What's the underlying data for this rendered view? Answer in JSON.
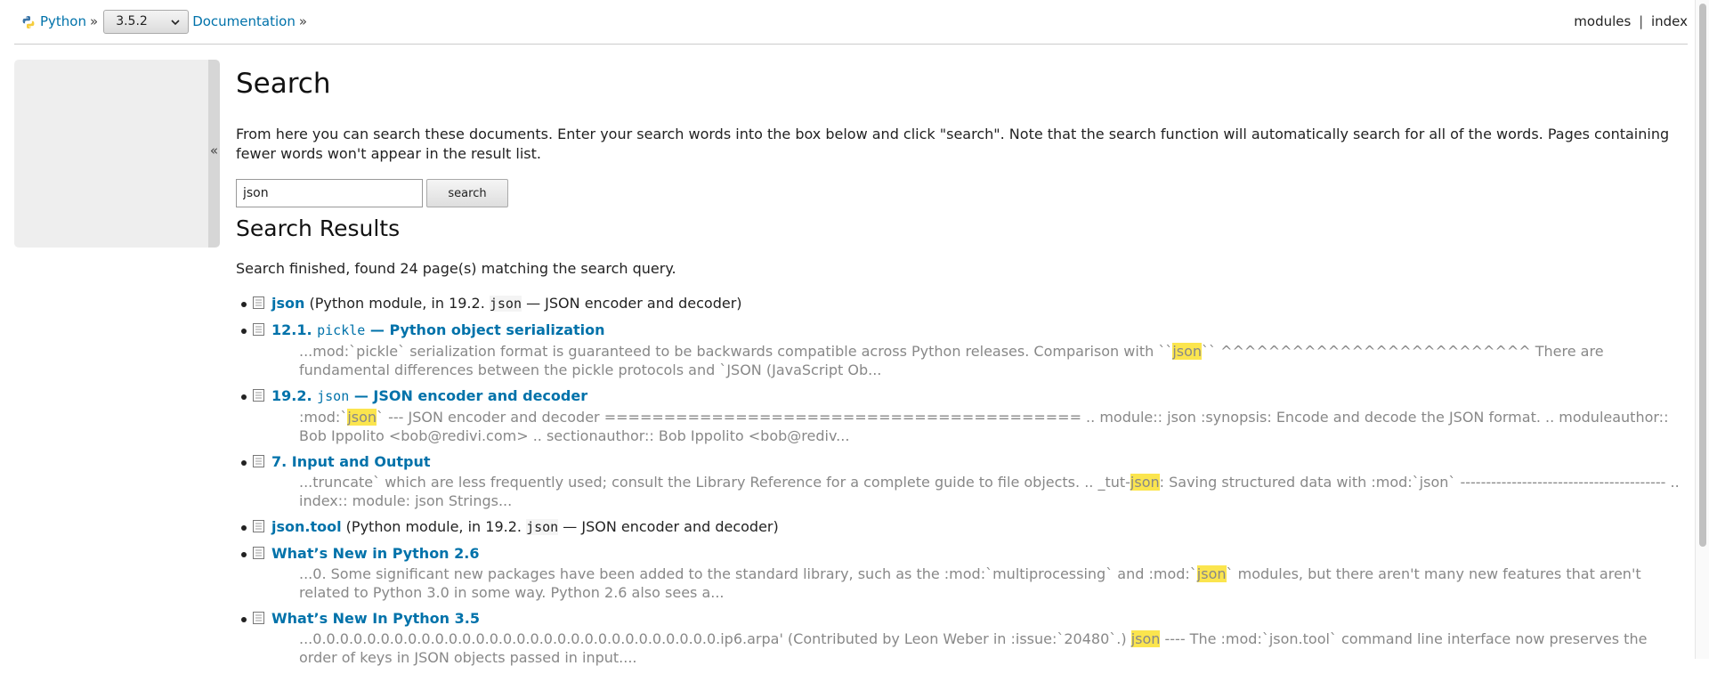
{
  "nav": {
    "python_label": "Python",
    "chevron": "»",
    "version": "3.5.2",
    "documentation_label": "Documentation",
    "modules": "modules",
    "divider": "|",
    "index": "index"
  },
  "sidebar": {
    "toggle": "«"
  },
  "page": {
    "title": "Search",
    "intro": "From here you can search these documents. Enter your search words into the box below and click \"search\". Note that the search function will automatically search for all of the words. Pages containing fewer words won't appear in the result list."
  },
  "search": {
    "value": "json",
    "button": "search"
  },
  "results": {
    "heading": "Search Results",
    "status": "Search finished, found 24 page(s) matching the search query.",
    "items": [
      {
        "title": "json",
        "info_pre": " (Python module, in 19.2. ",
        "info_code": "json",
        "info_post": " — JSON encoder and decoder)"
      },
      {
        "title_pre": "12.1. ",
        "title_code": "pickle",
        "title_post": " — Python object serialization",
        "context_pre": "...mod:`pickle` serialization format is guaranteed to be backwards compatible across Python releases. Comparison with ``",
        "context_hl": "json",
        "context_post": "`` ^^^^^^^^^^^^^^^^^^^^^^^^^^ There are fundamental differences between the pickle protocols and `JSON (JavaScript Ob..."
      },
      {
        "title_pre": "19.2. ",
        "title_code": "json",
        "title_post": " — JSON encoder and decoder",
        "context_pre": ":mod:`",
        "context_hl": "json",
        "context_post": "` --- JSON encoder and decoder ======================================== .. module:: json :synopsis: Encode and decode the JSON format. .. moduleauthor:: Bob Ippolito <bob@redivi.com> .. sectionauthor:: Bob Ippolito <bob@rediv..."
      },
      {
        "title": "7. Input and Output",
        "context_pre": "...truncate` which are less frequently used; consult the Library Reference for a complete guide to file objects. .. _tut-",
        "context_hl": "json",
        "context_post": ": Saving structured data with :mod:`json` ---------------------------------------- .. index:: module: json Strings..."
      },
      {
        "title": "json.tool",
        "info_pre": " (Python module, in 19.2. ",
        "info_code": "json",
        "info_post": " — JSON encoder and decoder)"
      },
      {
        "title": "What’s New in Python 2.6",
        "context_pre": "...0. Some significant new packages have been added to the standard library, such as the :mod:`multiprocessing` and :mod:`",
        "context_hl": "json",
        "context_post": "` modules, but there aren't many new features that aren't related to Python 3.0 in some way. Python 2.6 also sees a..."
      },
      {
        "title": "What’s New In Python 3.5",
        "context_pre": "...0.0.0.0.0.0.0.0.0.0.0.0.0.0.0.0.0.0.0.0.0.0.0.0.0.0.0.0.0.0.ip6.arpa' (Contributed by Leon Weber in :issue:`20480`.) ",
        "context_hl": "json",
        "context_post": " ---- The :mod:`json.tool` command line interface now preserves the order of keys in JSON objects passed in input...."
      }
    ]
  },
  "colors": {
    "link": "#0072aa",
    "highlight": "#fbe54e",
    "sidebar": "#eeeeee",
    "context_text": "#888888"
  },
  "icons": {
    "logo": "python-logo-icon",
    "dropdown": "chevron-down-icon",
    "result": "document-icon"
  }
}
